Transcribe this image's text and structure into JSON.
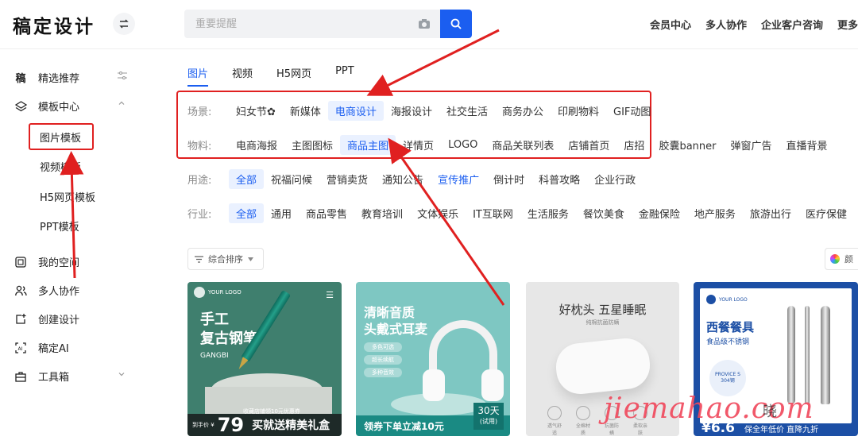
{
  "header": {
    "logo": "稿定设计",
    "search_placeholder": "重要提醒",
    "links": [
      "会员中心",
      "多人协作",
      "企业客户咨询",
      "更多产"
    ]
  },
  "sidebar": {
    "recommend": "精选推荐",
    "recommend_icon": "稿",
    "template_center": "模板中心",
    "sub_items": [
      "图片模板",
      "视频模板",
      "H5网页模板",
      "PPT模板"
    ],
    "my_space": "我的空间",
    "collab": "多人协作",
    "create": "创建设计",
    "ai": "稿定AI",
    "toolbox": "工具箱"
  },
  "tabs": [
    "图片",
    "视频",
    "H5网页",
    "PPT"
  ],
  "filters": {
    "scene": {
      "label": "场景:",
      "options": [
        "妇女节✿",
        "新媒体",
        "电商设计",
        "海报设计",
        "社交生活",
        "商务办公",
        "印刷物料",
        "GIF动图"
      ],
      "selected": 2
    },
    "material": {
      "label": "物料:",
      "options": [
        "电商海报",
        "主图图标",
        "商品主图",
        "详情页",
        "LOGO",
        "商品关联列表",
        "店铺首页",
        "店招",
        "胶囊banner",
        "弹窗广告",
        "直播背景"
      ],
      "selected": 2
    },
    "usage": {
      "label": "用途:",
      "options": [
        "全部",
        "祝福问候",
        "营销卖货",
        "通知公告",
        "宣传推广",
        "倒计时",
        "科普攻略",
        "企业行政"
      ],
      "selected": 0,
      "highlight": 4
    },
    "industry": {
      "label": "行业:",
      "options": [
        "全部",
        "通用",
        "商品零售",
        "教育培训",
        "文体娱乐",
        "IT互联网",
        "生活服务",
        "餐饮美食",
        "金融保险",
        "地产服务",
        "旅游出行",
        "医疗保健"
      ],
      "selected": 0
    }
  },
  "sort": {
    "label": "综合排序"
  },
  "color_label": "颜",
  "cards": {
    "c1": {
      "logo": "YOUR LOGO",
      "title_1": "手工",
      "title_2": "复古钢笔",
      "sub": "GANGBI",
      "ribbon": "收藏店铺领10元优惠券",
      "price_prefix": "到手价 ¥",
      "price": "79",
      "tag": "买就送精美礼盒"
    },
    "c2": {
      "title_1": "清晰音质",
      "title_2": "头戴式耳麦",
      "pills": [
        "多色可选",
        "超长续航",
        "多种音效"
      ],
      "bottom": "领券下单立减10元",
      "badge": "30天",
      "badge_sub": "(试用)"
    },
    "c3": {
      "title": "好枕头 五星睡眠",
      "sub": "纯棉抗菌防螨",
      "icons": [
        "透气舒适",
        "全棉材质",
        "抗菌防螨",
        "柔软亲肤"
      ]
    },
    "c4": {
      "logo": "YOUR LOGO",
      "title": "西餐餐具",
      "sub": "食品级不锈钢",
      "circle_1": "PROVICE S",
      "circle_2": "304钢",
      "price": "¥6.6",
      "bottom": "保全年低价 直降九折"
    }
  },
  "watermark": "jiemahao.com",
  "watermark_small": "晓"
}
